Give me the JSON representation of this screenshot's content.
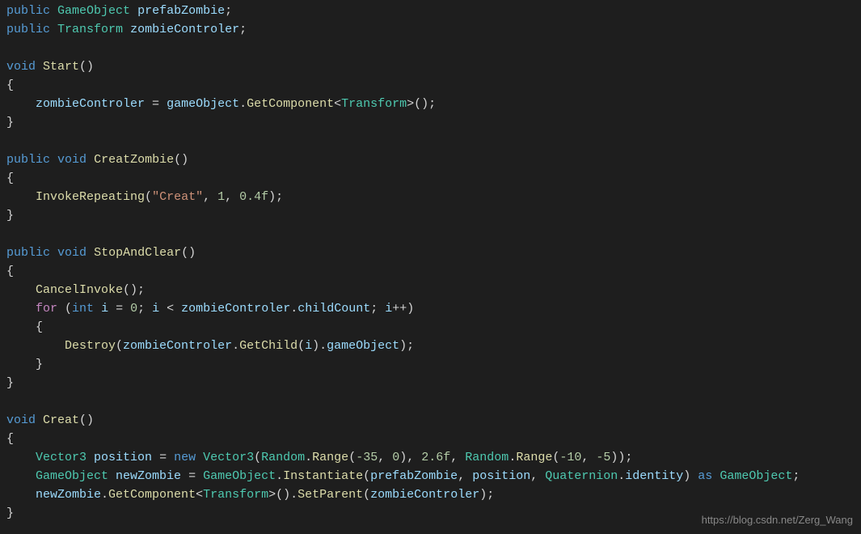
{
  "code": {
    "line1": {
      "kw_public": "public",
      "type": "GameObject",
      "var": "prefabZombie",
      "semi": ";"
    },
    "line2": {
      "kw_public": "public",
      "type": "Transform",
      "var": "zombieControler",
      "semi": ";"
    },
    "line4": {
      "kw_void": "void",
      "method": "Start",
      "parens": "()"
    },
    "line5_brace": "{",
    "line6": {
      "var1": "zombieControler",
      "eq": " = ",
      "var2": "gameObject",
      "dot1": ".",
      "method": "GetComponent",
      "lt": "<",
      "type": "Transform",
      "gt": ">",
      "call": "();"
    },
    "line7_brace": "}",
    "line9": {
      "kw_public": "public",
      "kw_void": "void",
      "method": "CreatZombie",
      "parens": "()"
    },
    "line10_brace": "{",
    "line11": {
      "method": "InvokeRepeating",
      "open": "(",
      "str": "\"Creat\"",
      "comma1": ", ",
      "num1": "1",
      "comma2": ", ",
      "num2": "0.4f",
      "close": ");"
    },
    "line12_brace": "}",
    "line14": {
      "kw_public": "public",
      "kw_void": "void",
      "method": "StopAndClear",
      "parens": "()"
    },
    "line15_brace": "{",
    "line16": {
      "method": "CancelInvoke",
      "call": "();"
    },
    "line17": {
      "kw_for": "for",
      "open": " (",
      "kw_int": "int",
      "sp": " ",
      "var_i": "i",
      "eq": " = ",
      "num0": "0",
      "semi1": "; ",
      "var_i2": "i",
      "lt": " < ",
      "var_zc": "zombieControler",
      "dot": ".",
      "var_cc": "childCount",
      "semi2": "; ",
      "var_i3": "i",
      "inc": "++)"
    },
    "line18_brace": "{",
    "line19": {
      "method": "Destroy",
      "open": "(",
      "var_zc": "zombieControler",
      "dot1": ".",
      "method2": "GetChild",
      "open2": "(",
      "var_i": "i",
      "close2": ").",
      "var_go": "gameObject",
      "close": ");"
    },
    "line20_brace": "}",
    "line21_brace": "}",
    "line23": {
      "kw_void": "void",
      "method": "Creat",
      "parens": "()"
    },
    "line24_brace": "{",
    "line25": {
      "type": "Vector3",
      "sp1": " ",
      "var": "position",
      "eq": " = ",
      "kw_new": "new",
      "sp2": " ",
      "type2": "Vector3",
      "open": "(",
      "type3": "Random",
      "dot1": ".",
      "method1": "Range",
      "open2": "(",
      "num1": "-35",
      "comma1": ", ",
      "num2": "0",
      "close2": "), ",
      "num3": "2.6f",
      "comma2": ", ",
      "type4": "Random",
      "dot2": ".",
      "method2": "Range",
      "open3": "(",
      "num4": "-10",
      "comma3": ", ",
      "num5": "-5",
      "close3": "));"
    },
    "line26": {
      "type": "GameObject",
      "sp1": " ",
      "var": "newZombie",
      "eq": " = ",
      "type2": "GameObject",
      "dot1": ".",
      "method": "Instantiate",
      "open": "(",
      "var2": "prefabZombie",
      "comma1": ", ",
      "var3": "position",
      "comma2": ", ",
      "type3": "Quaternion",
      "dot2": ".",
      "var4": "identity",
      "close": ") ",
      "kw_as": "as",
      "sp2": " ",
      "type4": "GameObject",
      "semi": ";"
    },
    "line27": {
      "var": "newZombie",
      "dot1": ".",
      "method": "GetComponent",
      "lt": "<",
      "type": "Transform",
      "gt": ">",
      "call": "().",
      "method2": "SetParent",
      "open": "(",
      "var2": "zombieControler",
      "close": ");"
    },
    "line28_brace": "}"
  },
  "watermark": "https://blog.csdn.net/Zerg_Wang"
}
